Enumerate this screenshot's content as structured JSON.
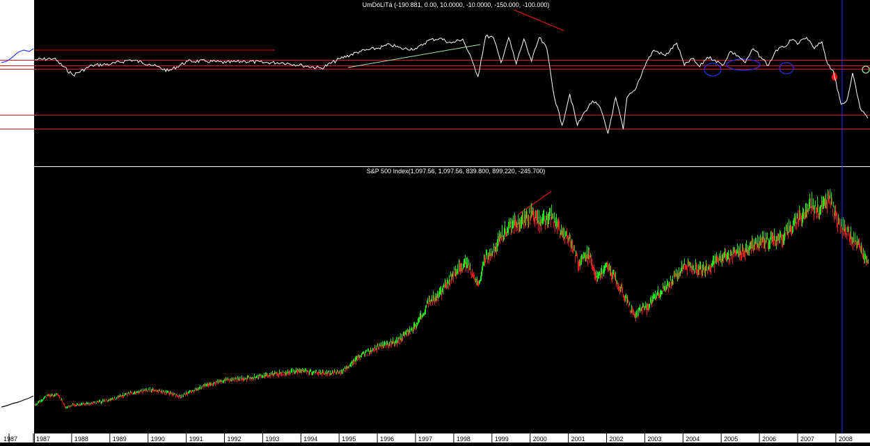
{
  "chart_data": [
    {
      "type": "line",
      "title": "UmDóLiTá (-190.881, 0.00, 10.0000, -10.0000, -150.000, -100.000)",
      "series": [
        {
          "x": [
            "1987.00",
            "1987.50",
            "1988.00",
            "1988.50",
            "1989.00",
            "1989.50",
            "1990.00",
            "1990.50",
            "1991.00",
            "1991.50",
            "1992.00",
            "1992.50",
            "1993.00",
            "1993.50",
            "1994.00",
            "1994.50",
            "1995.00",
            "1995.50",
            "1996.00",
            "1996.30",
            "1996.60",
            "1997.00",
            "1997.30",
            "1997.60",
            "1997.90",
            "1998.20",
            "1998.50",
            "1998.60",
            "1998.80",
            "1999.00",
            "1999.20",
            "1999.40",
            "1999.60",
            "1999.80",
            "2000.00",
            "2000.20",
            "2000.40",
            "2000.60",
            "2000.80",
            "2001.00",
            "2001.20",
            "2001.40",
            "2001.60",
            "2001.80",
            "2002.00",
            "2002.20",
            "2002.40",
            "2002.50",
            "2002.70",
            "2003.00",
            "2003.20",
            "2003.50",
            "2003.80",
            "2004.00",
            "2004.20",
            "2004.40",
            "2004.60",
            "2004.80",
            "2005.00",
            "2005.20",
            "2005.40",
            "2005.60",
            "2005.80",
            "2006.00",
            "2006.20",
            "2006.40",
            "2006.60",
            "2006.80",
            "2007.00",
            "2007.20",
            "2007.40",
            "2007.60",
            "2007.75",
            "2007.90",
            "2008.00",
            "2008.10",
            "2008.25",
            "2008.40",
            "2008.60",
            "2008.80"
          ],
          "values": [
            14,
            16,
            -8,
            6,
            8,
            14,
            8,
            -2,
            12,
            12,
            10,
            12,
            10,
            10,
            6,
            2,
            16,
            26,
            31,
            36,
            30,
            30,
            42,
            45,
            38,
            44,
            5,
            -10,
            48,
            46,
            10,
            46,
            8,
            44,
            12,
            46,
            30,
            -40,
            -80,
            -35,
            -80,
            -60,
            -45,
            -55,
            -92,
            -40,
            -86,
            -40,
            -30,
            10,
            28,
            20,
            38,
            6,
            16,
            4,
            18,
            14,
            6,
            26,
            20,
            10,
            30,
            18,
            6,
            28,
            32,
            42,
            38,
            46,
            30,
            40,
            8,
            -2,
            -28,
            -50,
            -45,
            -5,
            -55,
            -70
          ]
        }
      ],
      "hlines": [
        14,
        6,
        1,
        -65,
        -85
      ],
      "ylim": [
        -100,
        55
      ]
    },
    {
      "type": "line",
      "title": "S&P 500 Index(1,097.56, 1,097.56, 839.800, 899.220, -245.700)",
      "x_tick_labels": [
        "1987",
        "1987",
        "1988",
        "1989",
        "1990",
        "1991",
        "1992",
        "1993",
        "1994",
        "1995",
        "1996",
        "1997",
        "1998",
        "1999",
        "2000",
        "2001",
        "2002",
        "2003",
        "2004",
        "2005",
        "2006",
        "2007",
        "2008"
      ],
      "series": [
        {
          "x": [
            "1986.75",
            "1987.00",
            "1987.30",
            "1987.60",
            "1987.80",
            "1988.00",
            "1988.50",
            "1989.00",
            "1989.50",
            "1990.00",
            "1990.50",
            "1990.80",
            "1991.00",
            "1991.50",
            "1992.00",
            "1992.50",
            "1993.00",
            "1993.50",
            "1994.00",
            "1994.50",
            "1995.00",
            "1995.50",
            "1996.00",
            "1996.50",
            "1997.00",
            "1997.30",
            "1997.60",
            "1998.00",
            "1998.30",
            "1998.60",
            "1998.80",
            "1999.00",
            "1999.30",
            "1999.60",
            "1999.80",
            "2000.00",
            "2000.20",
            "2000.50",
            "2000.80",
            "2001.00",
            "2001.20",
            "2001.50",
            "2001.70",
            "2002.00",
            "2002.30",
            "2002.50",
            "2002.70",
            "2002.90",
            "2003.00",
            "2003.30",
            "2003.60",
            "2004.00",
            "2004.50",
            "2005.00",
            "2005.50",
            "2006.00",
            "2006.50",
            "2007.00",
            "2007.30",
            "2007.50",
            "2007.70",
            "2007.80",
            "2008.00",
            "2008.20",
            "2008.40",
            "2008.60",
            "2008.80"
          ],
          "values": [
            245,
            255,
            310,
            320,
            235,
            255,
            265,
            290,
            330,
            350,
            330,
            305,
            330,
            380,
            410,
            420,
            440,
            455,
            470,
            455,
            460,
            560,
            620,
            660,
            760,
            900,
            950,
            1100,
            1150,
            1000,
            1180,
            1230,
            1350,
            1400,
            1420,
            1460,
            1400,
            1440,
            1330,
            1300,
            1150,
            1200,
            1050,
            1120,
            1000,
            900,
            800,
            880,
            860,
            950,
            1020,
            1130,
            1100,
            1180,
            1220,
            1280,
            1300,
            1430,
            1510,
            1480,
            1530,
            1560,
            1400,
            1350,
            1300,
            1240,
            1150
          ]
        }
      ],
      "ylim": [
        220,
        1620
      ]
    }
  ]
}
